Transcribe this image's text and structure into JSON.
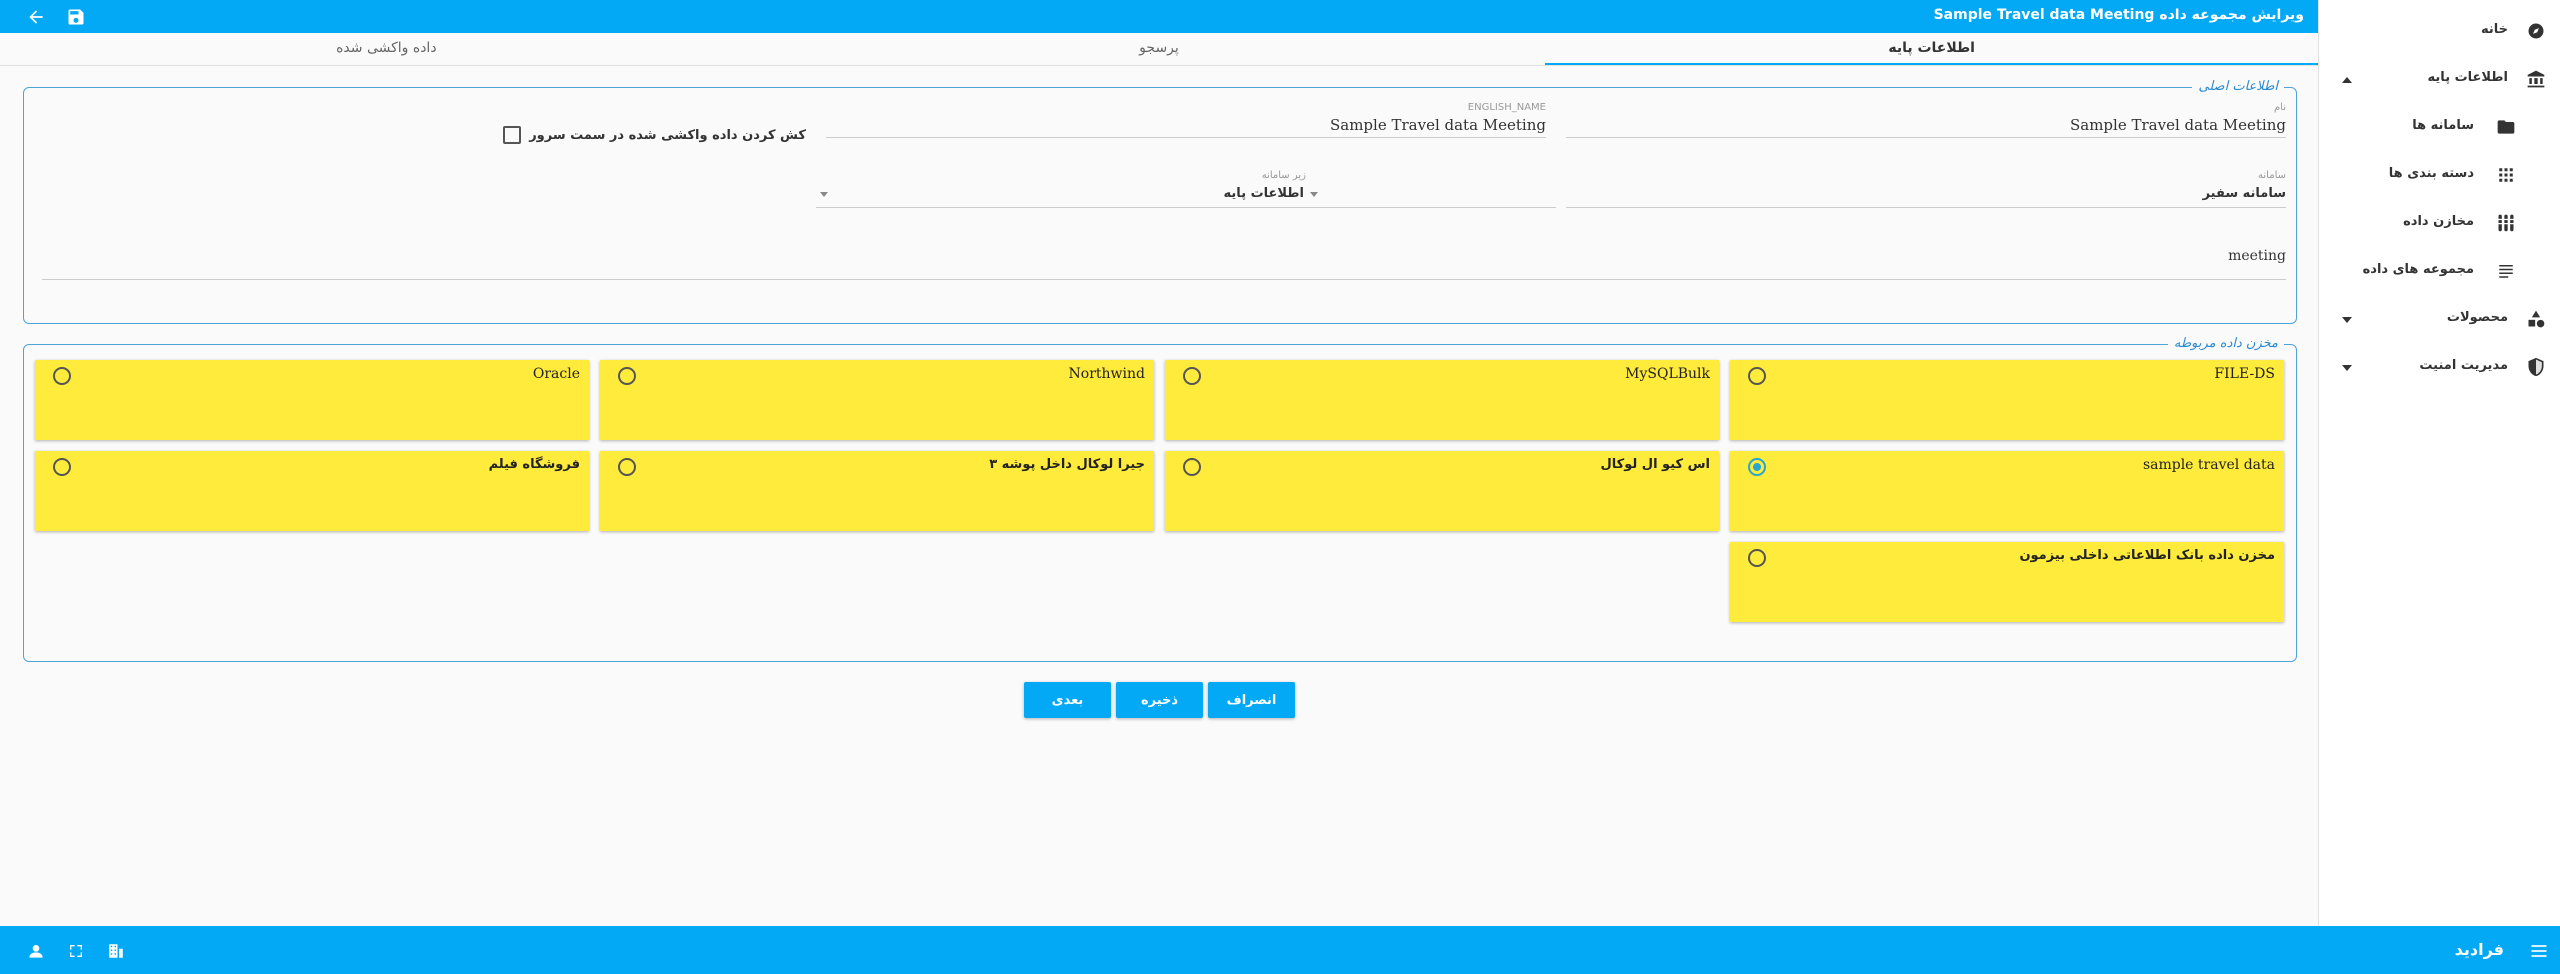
{
  "header": {
    "title": "ویرایش مجموعه داده Sample Travel data Meeting"
  },
  "tabs": [
    {
      "label": "اطلاعات پایه"
    },
    {
      "label": "پرسجو"
    },
    {
      "label": "داده واکشی شده"
    }
  ],
  "main_info": {
    "legend": "اطلاعات اصلی",
    "name_label": "نام",
    "name_value": "Sample Travel data Meeting",
    "english_name_label": "ENGLISH_NAME",
    "english_name_value": "Sample Travel data Meeting",
    "cache_checkbox_label": "کش کردن داده واکشی شده در سمت سرور",
    "system_label": "سامانه",
    "system_value": "سامانه سفیر",
    "subsystem_label": "زیر سامانه",
    "subsystem_value": "اطلاعات پایه",
    "description_value": "meeting"
  },
  "datastores": {
    "legend": "مخزن داده مربوطه",
    "selected": "sample travel data",
    "items": [
      {
        "label": "FILE-DS"
      },
      {
        "label": "MySQLBulk"
      },
      {
        "label": "Northwind"
      },
      {
        "label": "Oracle"
      },
      {
        "label": "sample travel data"
      },
      {
        "label": "اس کیو ال لوکال"
      },
      {
        "label": "جیرا لوکال داخل پوشه ۳"
      },
      {
        "label": "فروشگاه فیلم"
      },
      {
        "label": "مخزن داده بانک اطلاعاتی داخلی بیزمون"
      }
    ]
  },
  "buttons": {
    "cancel": "انصراف",
    "save": "ذخیره",
    "next": "بعدی"
  },
  "sidebar": {
    "items": [
      {
        "label": "خانه",
        "icon": "compass-icon"
      },
      {
        "label": "اطلاعات پایه",
        "icon": "bank-icon"
      },
      {
        "label": "سامانه ها",
        "icon": "folder-icon"
      },
      {
        "label": "دسته بندی ها",
        "icon": "apps-grid-icon"
      },
      {
        "label": "مخازن داده",
        "icon": "database-icon"
      },
      {
        "label": "مجموعه های داده",
        "icon": "list-icon"
      },
      {
        "label": "محصولات",
        "icon": "shapes-icon"
      },
      {
        "label": "مدیریت امنیت",
        "icon": "shield-icon"
      }
    ]
  },
  "footer": {
    "brand": "فرادید"
  },
  "colors": {
    "primary": "#03a9f4",
    "card": "#ffeb3b",
    "legend": "#2a8ad0"
  }
}
